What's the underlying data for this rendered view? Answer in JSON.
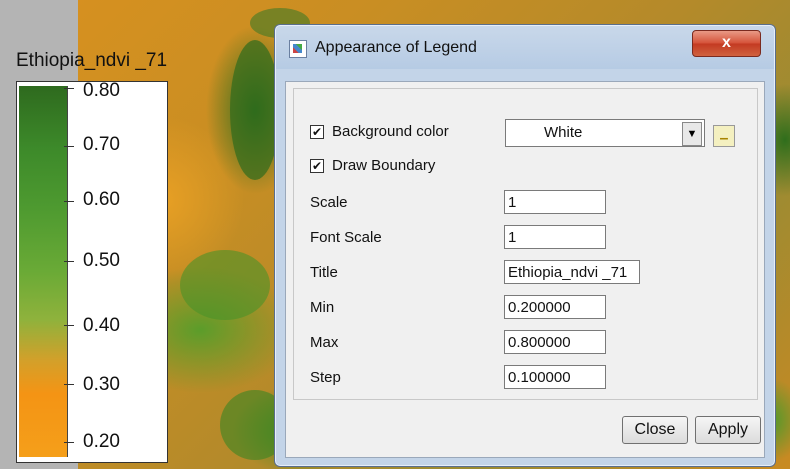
{
  "legend": {
    "title": "Ethiopia_ndvi _71",
    "ticks": [
      "0.80",
      "0.70",
      "0.60",
      "0.50",
      "0.40",
      "0.30",
      "0.20"
    ]
  },
  "dialog": {
    "title": "Appearance of Legend",
    "close_icon": "x",
    "background_color": {
      "label": "Background color",
      "checked": true,
      "value": "White"
    },
    "draw_boundary": {
      "label": "Draw Boundary",
      "checked": true
    },
    "fields": {
      "scale": {
        "label": "Scale",
        "value": "1"
      },
      "font_scale": {
        "label": "Font Scale",
        "value": "1"
      },
      "title": {
        "label": "Title",
        "value": "Ethiopia_ndvi _71"
      },
      "min": {
        "label": "Min",
        "value": "0.200000"
      },
      "max": {
        "label": "Max",
        "value": "0.800000"
      },
      "step": {
        "label": "Step",
        "value": "0.100000"
      }
    },
    "buttons": {
      "close": "Close",
      "apply": "Apply"
    }
  },
  "colors": {
    "legend_top": "#2e6a1e",
    "legend_bottom": "#f59f1a",
    "close_button": "#d5533a"
  },
  "icons": [
    "app-icon",
    "close-icon",
    "dropdown-arrow-icon",
    "color-picker-icon",
    "checkmark-icon"
  ]
}
